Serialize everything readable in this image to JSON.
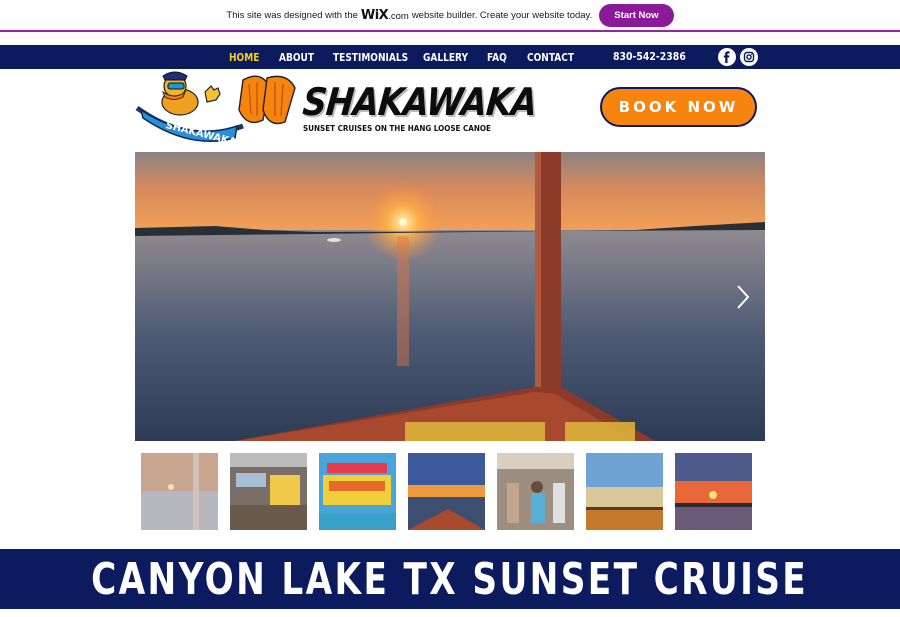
{
  "wix_banner": {
    "text_before": "This site was designed with the",
    "wix_logo": "WiX",
    "wix_com": ".com",
    "text_after": "website builder. Create your website today.",
    "cta_label": "Start Now"
  },
  "nav": {
    "items": [
      {
        "label": "HOME",
        "active": true
      },
      {
        "label": "ABOUT",
        "active": false
      },
      {
        "label": "TESTIMONIALS",
        "active": false
      },
      {
        "label": "GALLERY",
        "active": false
      },
      {
        "label": "FAQ",
        "active": false
      },
      {
        "label": "CONTACT",
        "active": false
      }
    ],
    "phone": "830-542-2386",
    "social_icons": [
      "facebook-icon",
      "instagram-icon"
    ]
  },
  "header": {
    "logo_badge_text": "SHAKAWAKA",
    "brand_title": "SHAKAWAKA",
    "brand_tagline": "SUNSET CRUISES ON THE HANG LOOSE CANOE",
    "book_button": "BOOK NOW"
  },
  "gallery": {
    "next_icon": "chevron-right-icon",
    "thumbnails": 7
  },
  "band": {
    "title": "CANYON LAKE TX SUNSET CRUISE"
  },
  "colors": {
    "navy": "#0c1a5e",
    "orange": "#f7840f",
    "active_nav": "#f7d118",
    "wix_purple": "#8a1a9a"
  }
}
